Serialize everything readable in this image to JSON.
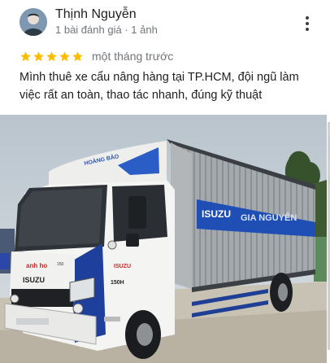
{
  "review": {
    "author": "Thịnh Nguyễn",
    "reviews_count": "1 bài đánh giá",
    "photos_count": "1 ảnh",
    "separator": "·",
    "rating": 5,
    "rating_max": 5,
    "date": "một tháng trước",
    "text": "Mình thuê xe cẩu nâng hàng tại TP.HCM, đội ngũ làm việc rất an toàn, thao tác nhanh, đúng kỹ thuật",
    "more_icon": "more-vert-icon",
    "star_color": "#fbbc04"
  },
  "photo": {
    "cab_brand": "ISUZU",
    "box_brand": "ISUZU",
    "box_tail_text": "GIA NGUYÊN",
    "cab_logo": "anh ho",
    "deflector_text": "HOÀNG BẢO",
    "model_badge": "150",
    "side_number": "150H",
    "colors": {
      "cab": "#f4f5f3",
      "blue": "#1e3f9c",
      "box": "#9aa0a6",
      "sky": "#c9d3db"
    }
  }
}
